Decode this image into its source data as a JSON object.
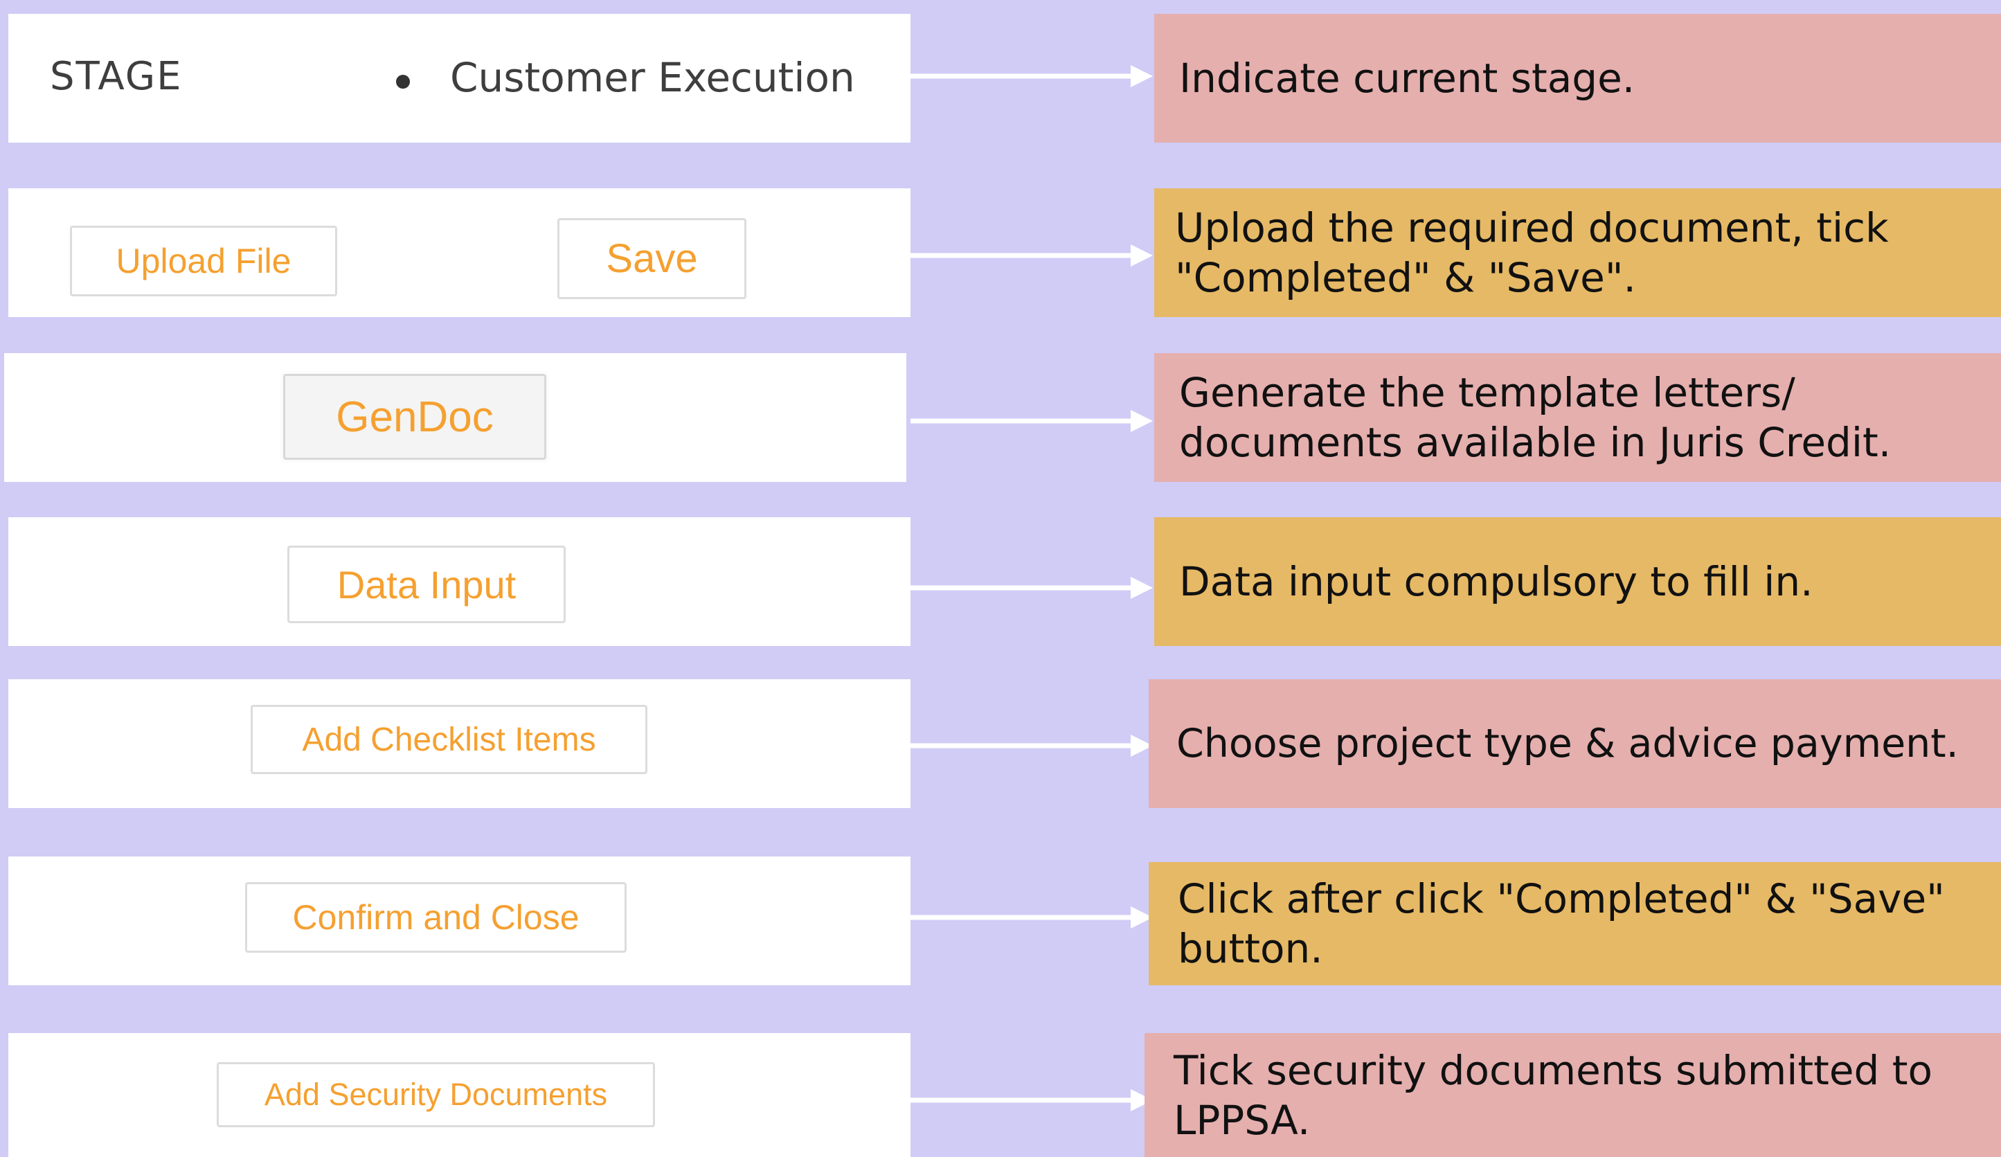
{
  "colors": {
    "background": "#d0ccf6",
    "panel": "#ffffff",
    "button_text": "#f5a030",
    "note_pink": "#e5afae",
    "note_gold": "#e6b966",
    "arrow": "#ffffff"
  },
  "stage": {
    "label": "STAGE",
    "value": "Customer Execution"
  },
  "buttons": {
    "upload_file": "Upload File",
    "save": "Save",
    "gendoc": "GenDoc",
    "data_input": "Data Input",
    "add_checklist_items": "Add Checklist Items",
    "confirm_and_close": "Confirm and Close",
    "add_security_documents": "Add Security Documents"
  },
  "notes": [
    {
      "lines": [
        "Indicate current stage."
      ],
      "color": "pink"
    },
    {
      "lines": [
        "Upload the required document, tick",
        "\"Completed\" & \"Save\"."
      ],
      "color": "gold"
    },
    {
      "lines": [
        "Generate the template letters/",
        "documents available in Juris Credit."
      ],
      "color": "pink"
    },
    {
      "lines": [
        "Data input compulsory to fill in."
      ],
      "color": "gold"
    },
    {
      "lines": [
        "Choose project type & advice payment."
      ],
      "color": "pink"
    },
    {
      "lines": [
        "Click after click \"Completed\" & \"Save\"",
        "button."
      ],
      "color": "gold"
    },
    {
      "lines": [
        "Tick security documents submitted to",
        "LPPSA."
      ],
      "color": "pink"
    }
  ]
}
